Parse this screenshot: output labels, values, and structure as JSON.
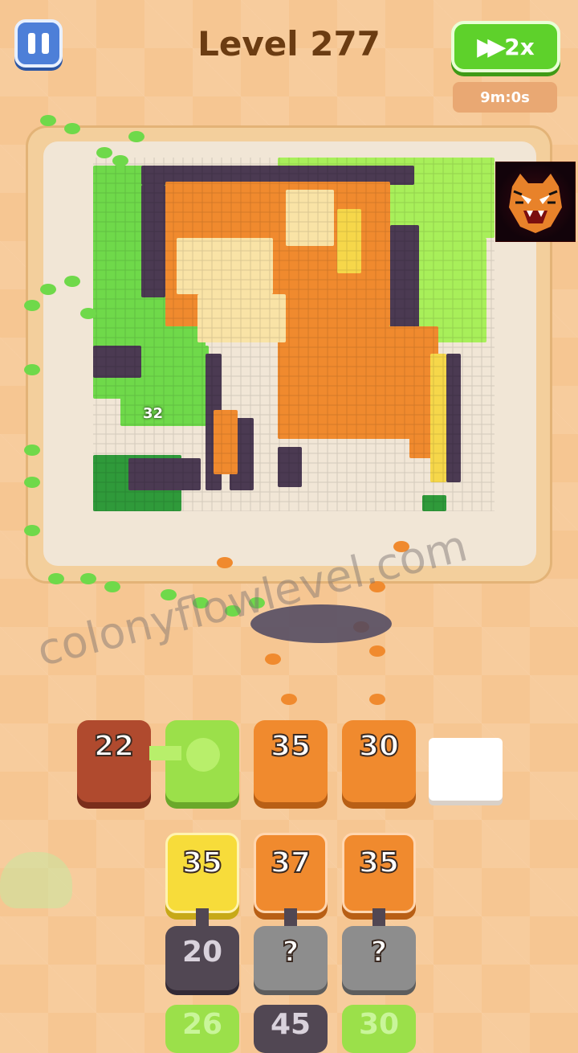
{
  "header": {
    "level_title": "Level 277",
    "speed_label": "2x",
    "timer": "9m:0s"
  },
  "board": {
    "counter": "32"
  },
  "watermark": "colonyflowlevel.com",
  "slots": [
    {
      "value": "22",
      "color": "#b04a2e"
    },
    {
      "value": "",
      "color": "#9be04a"
    },
    {
      "value": "35",
      "color": "#f08a2e"
    },
    {
      "value": "30",
      "color": "#f08a2e"
    },
    {
      "value": "",
      "color": "#ffffff"
    }
  ],
  "queue": [
    {
      "value": "35",
      "color": "#f7dc3a"
    },
    {
      "value": "37",
      "color": "#f08a2e"
    },
    {
      "value": "35",
      "color": "#f08a2e"
    }
  ],
  "queue_second": [
    {
      "value": "20",
      "color": "#514753"
    },
    {
      "value": "?",
      "color": "#8d8d8d"
    },
    {
      "value": "?",
      "color": "#8d8d8d"
    }
  ],
  "queue_third": [
    {
      "value": "26",
      "color": "#9be04a"
    },
    {
      "value": "45",
      "color": "#514753"
    },
    {
      "value": "30",
      "color": "#9be04a"
    }
  ],
  "colors": {
    "green": "#6fd94a",
    "lime": "#a8ef5a",
    "dark_green": "#2f9a3a",
    "orange": "#f08a2e",
    "cream": "#f9e3a6",
    "yellow": "#f6d74a",
    "purple": "#4b3a52",
    "brown": "#c2663a"
  },
  "icons": {
    "pause": "pause-icon",
    "speed": "fast-forward-icon"
  }
}
